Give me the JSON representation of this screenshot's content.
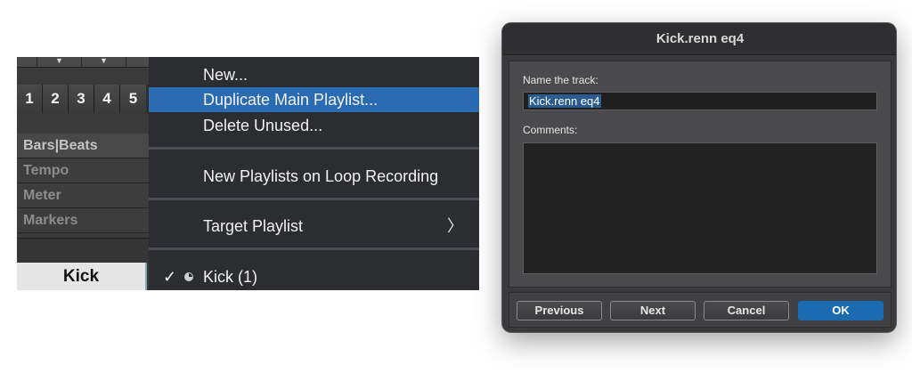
{
  "track_strip": {
    "arrows": [
      "▼",
      "▼"
    ],
    "numbers": [
      "1",
      "2",
      "3",
      "4",
      "5"
    ],
    "rulers": [
      {
        "label": "Bars|Beats",
        "active": true
      },
      {
        "label": "Tempo",
        "active": false
      },
      {
        "label": "Meter",
        "active": false
      },
      {
        "label": "Markers",
        "active": false
      }
    ],
    "track_name": "Kick"
  },
  "playlist_menu": {
    "new": "New...",
    "duplicate": "Duplicate Main Playlist...",
    "delete_unused": "Delete Unused...",
    "new_on_loop": "New Playlists on Loop Recording",
    "target_playlist": "Target Playlist",
    "target_chevron": "〉",
    "checkmark": "✓",
    "current_playlist": "Kick (1)"
  },
  "dialog": {
    "title": "Kick.renn eq4",
    "name_label": "Name the track:",
    "name_value": "Kick.renn eq4",
    "comments_label": "Comments:",
    "comments_value": "",
    "buttons": {
      "previous": "Previous",
      "next": "Next",
      "cancel": "Cancel",
      "ok": "OK"
    }
  },
  "colors": {
    "menu_highlight": "#2b6bb1",
    "primary_button": "#1b6bb0",
    "text_selection": "#2c5c8f"
  }
}
